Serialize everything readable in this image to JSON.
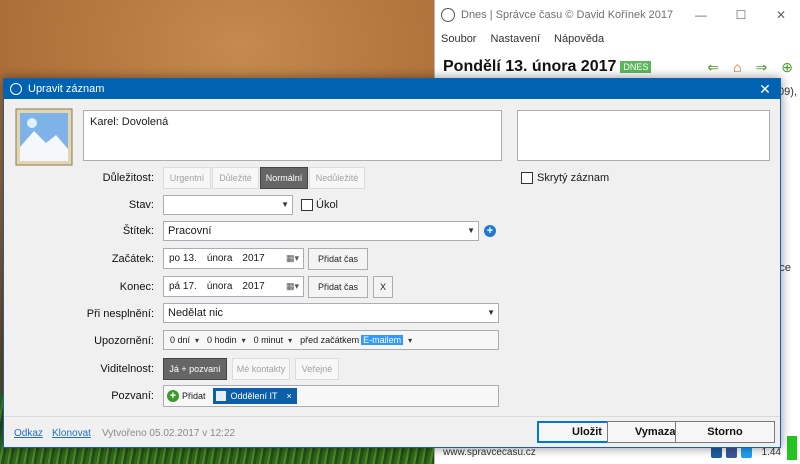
{
  "back_window": {
    "title": "Dnes | Správce času © David Kořínek 2017",
    "menu": [
      "Soubor",
      "Nastavení",
      "Nápověda"
    ],
    "date_title": "Pondělí 13. února 2017",
    "today_badge": "DNES",
    "snippet_right": "09),",
    "snippet_right2": "ce",
    "footer_url": "www.spravcecasu.cz",
    "version": "1.44",
    "window_controls": [
      "—",
      "☐",
      "✕"
    ]
  },
  "dialog": {
    "title": "Upravit záznam",
    "close_glyph": "✕",
    "note_text": "Karel: Dovolená",
    "hidden_label": "Skrytý záznam",
    "importance": {
      "label": "Důležitost:",
      "options": [
        "Urgentní",
        "Důležité",
        "Normální",
        "Nedůležité"
      ],
      "selected": "Normální"
    },
    "status": {
      "label": "Stav:",
      "value": "",
      "task_label": "Úkol"
    },
    "tag": {
      "label": "Štítek:",
      "value": "Pracovní"
    },
    "start": {
      "label": "Začátek:",
      "day": "po 13.",
      "month": "února",
      "year": "2017",
      "add_time": "Přidat čas"
    },
    "end": {
      "label": "Konec:",
      "day": "pá 17.",
      "month": "února",
      "year": "2017",
      "add_time": "Přidat čas",
      "clear": "X"
    },
    "on_fail": {
      "label": "Při nesplnění:",
      "value": "Nedělat nic"
    },
    "reminder": {
      "label": "Upozornění:",
      "days": "0 dní",
      "hours": "0 hodin",
      "minutes": "0 minut",
      "before": "před začátkem",
      "method": "E-mailem"
    },
    "visibility": {
      "label": "Viditelnost:",
      "options": [
        "Já + pozvaní",
        "Mé kontakty",
        "Veřejné"
      ],
      "selected": "Já + pozvaní"
    },
    "invited": {
      "label": "Pozvaní:",
      "add_label": "Přidat",
      "chip": "Oddělení IT",
      "chip_remove": "×"
    },
    "footer": {
      "link_odkaz": "Odkaz",
      "link_klonovat": "Klonovat",
      "created": "Vytvořeno 05.02.2017 v 12:22",
      "save": "Uložit",
      "delete": "Vymazat",
      "cancel": "Storno"
    }
  },
  "colors": {
    "title_blue": "#0063b1",
    "add_green": "#3a9a2a",
    "tag_blue": "#1f78d1",
    "chip_blue": "#0c5fa8",
    "highlight": "#3399ff"
  }
}
